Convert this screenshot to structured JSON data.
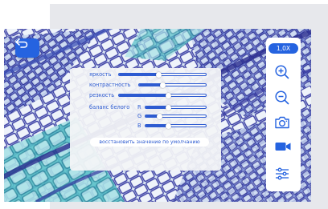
{
  "viewer": {
    "back_icon": "back-arrow-icon",
    "accent_color": "#2563e0"
  },
  "adjustments": {
    "brightness": {
      "label": "яркость",
      "value": 0.46
    },
    "contrast": {
      "label": "контрастность",
      "value": 0.35
    },
    "sharpness": {
      "label": "резкость",
      "value": 0.57
    },
    "white_balance": {
      "label": "баланс белого",
      "channels": [
        {
          "label": "R",
          "value": 0.38
        },
        {
          "label": "G",
          "value": 0.23
        },
        {
          "label": "B",
          "value": 0.38
        }
      ]
    },
    "reset_label": "восстановить значение по умолчанию"
  },
  "toolbar": {
    "zoom_level": "1,0X",
    "tools": [
      {
        "name": "zoom-in",
        "icon": "zoom-in-icon"
      },
      {
        "name": "zoom-out",
        "icon": "zoom-out-icon"
      },
      {
        "name": "snapshot",
        "icon": "camera-icon"
      },
      {
        "name": "record",
        "icon": "video-camera-icon"
      },
      {
        "name": "adjust",
        "icon": "sliders-icon"
      }
    ]
  }
}
